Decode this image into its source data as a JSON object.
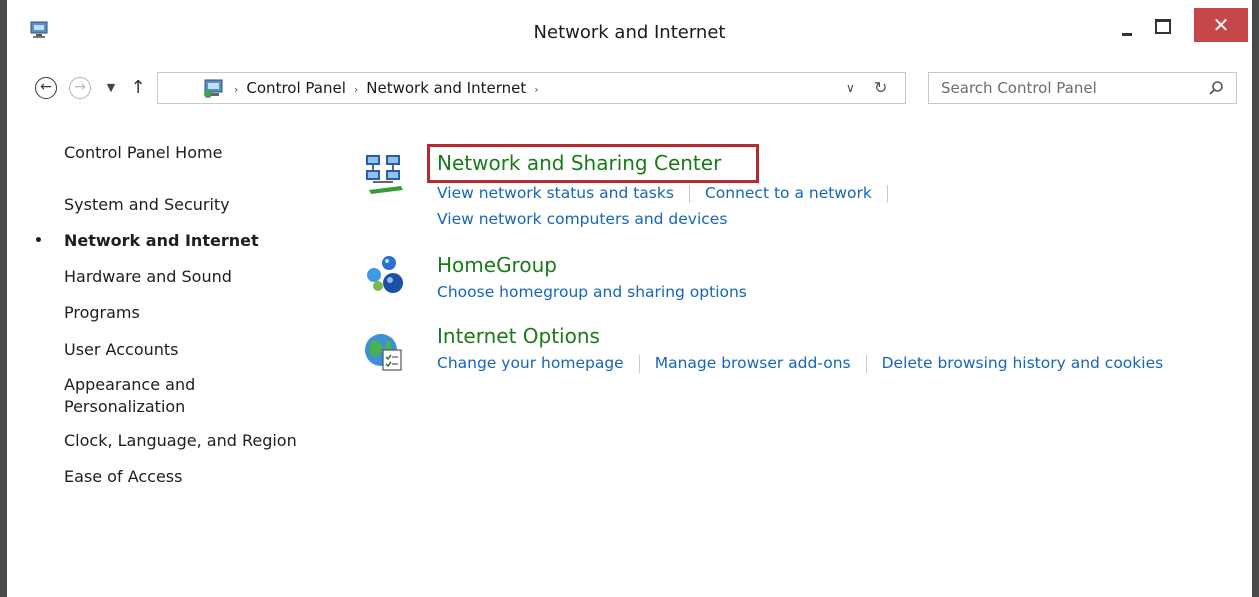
{
  "window": {
    "title": "Network and Internet",
    "close_glyph": "✕",
    "accent_close": "#c5474a"
  },
  "navbar": {
    "back_glyph": "←",
    "forward_glyph": "→",
    "recent_glyph": "▼",
    "up_glyph": "↑",
    "breadcrumbs": [
      "Control Panel",
      "Network and Internet"
    ],
    "crumb_sep": "›",
    "dropdown_glyph": "∨",
    "refresh_glyph": "↻"
  },
  "search": {
    "placeholder": "Search Control Panel"
  },
  "sidebar": {
    "items": [
      {
        "label": "Control Panel Home"
      },
      {
        "label": "System and Security"
      },
      {
        "label": "Network and Internet",
        "current": true
      },
      {
        "label": "Hardware and Sound"
      },
      {
        "label": "Programs"
      },
      {
        "label": "User Accounts"
      },
      {
        "label": "Appearance and Personalization",
        "line1": "Appearance and",
        "line2": "Personalization"
      },
      {
        "label": "Clock, Language, and Region"
      },
      {
        "label": "Ease of Access"
      }
    ],
    "bullet": "•"
  },
  "categories": [
    {
      "title": "Network and Sharing Center",
      "icon": "network-icon",
      "links": [
        "View network status and tasks",
        "Connect to a network",
        "View network computers and devices"
      ],
      "highlighted": true
    },
    {
      "title": "HomeGroup",
      "icon": "homegroup-icon",
      "links": [
        "Choose homegroup and sharing options"
      ]
    },
    {
      "title": "Internet Options",
      "icon": "internet-options-icon",
      "links": [
        "Change your homepage",
        "Manage browser add-ons",
        "Delete browsing history and cookies"
      ]
    }
  ],
  "colors": {
    "category_title": "#1a7a1a",
    "link": "#1665b8",
    "highlight": "#b52a2e"
  }
}
